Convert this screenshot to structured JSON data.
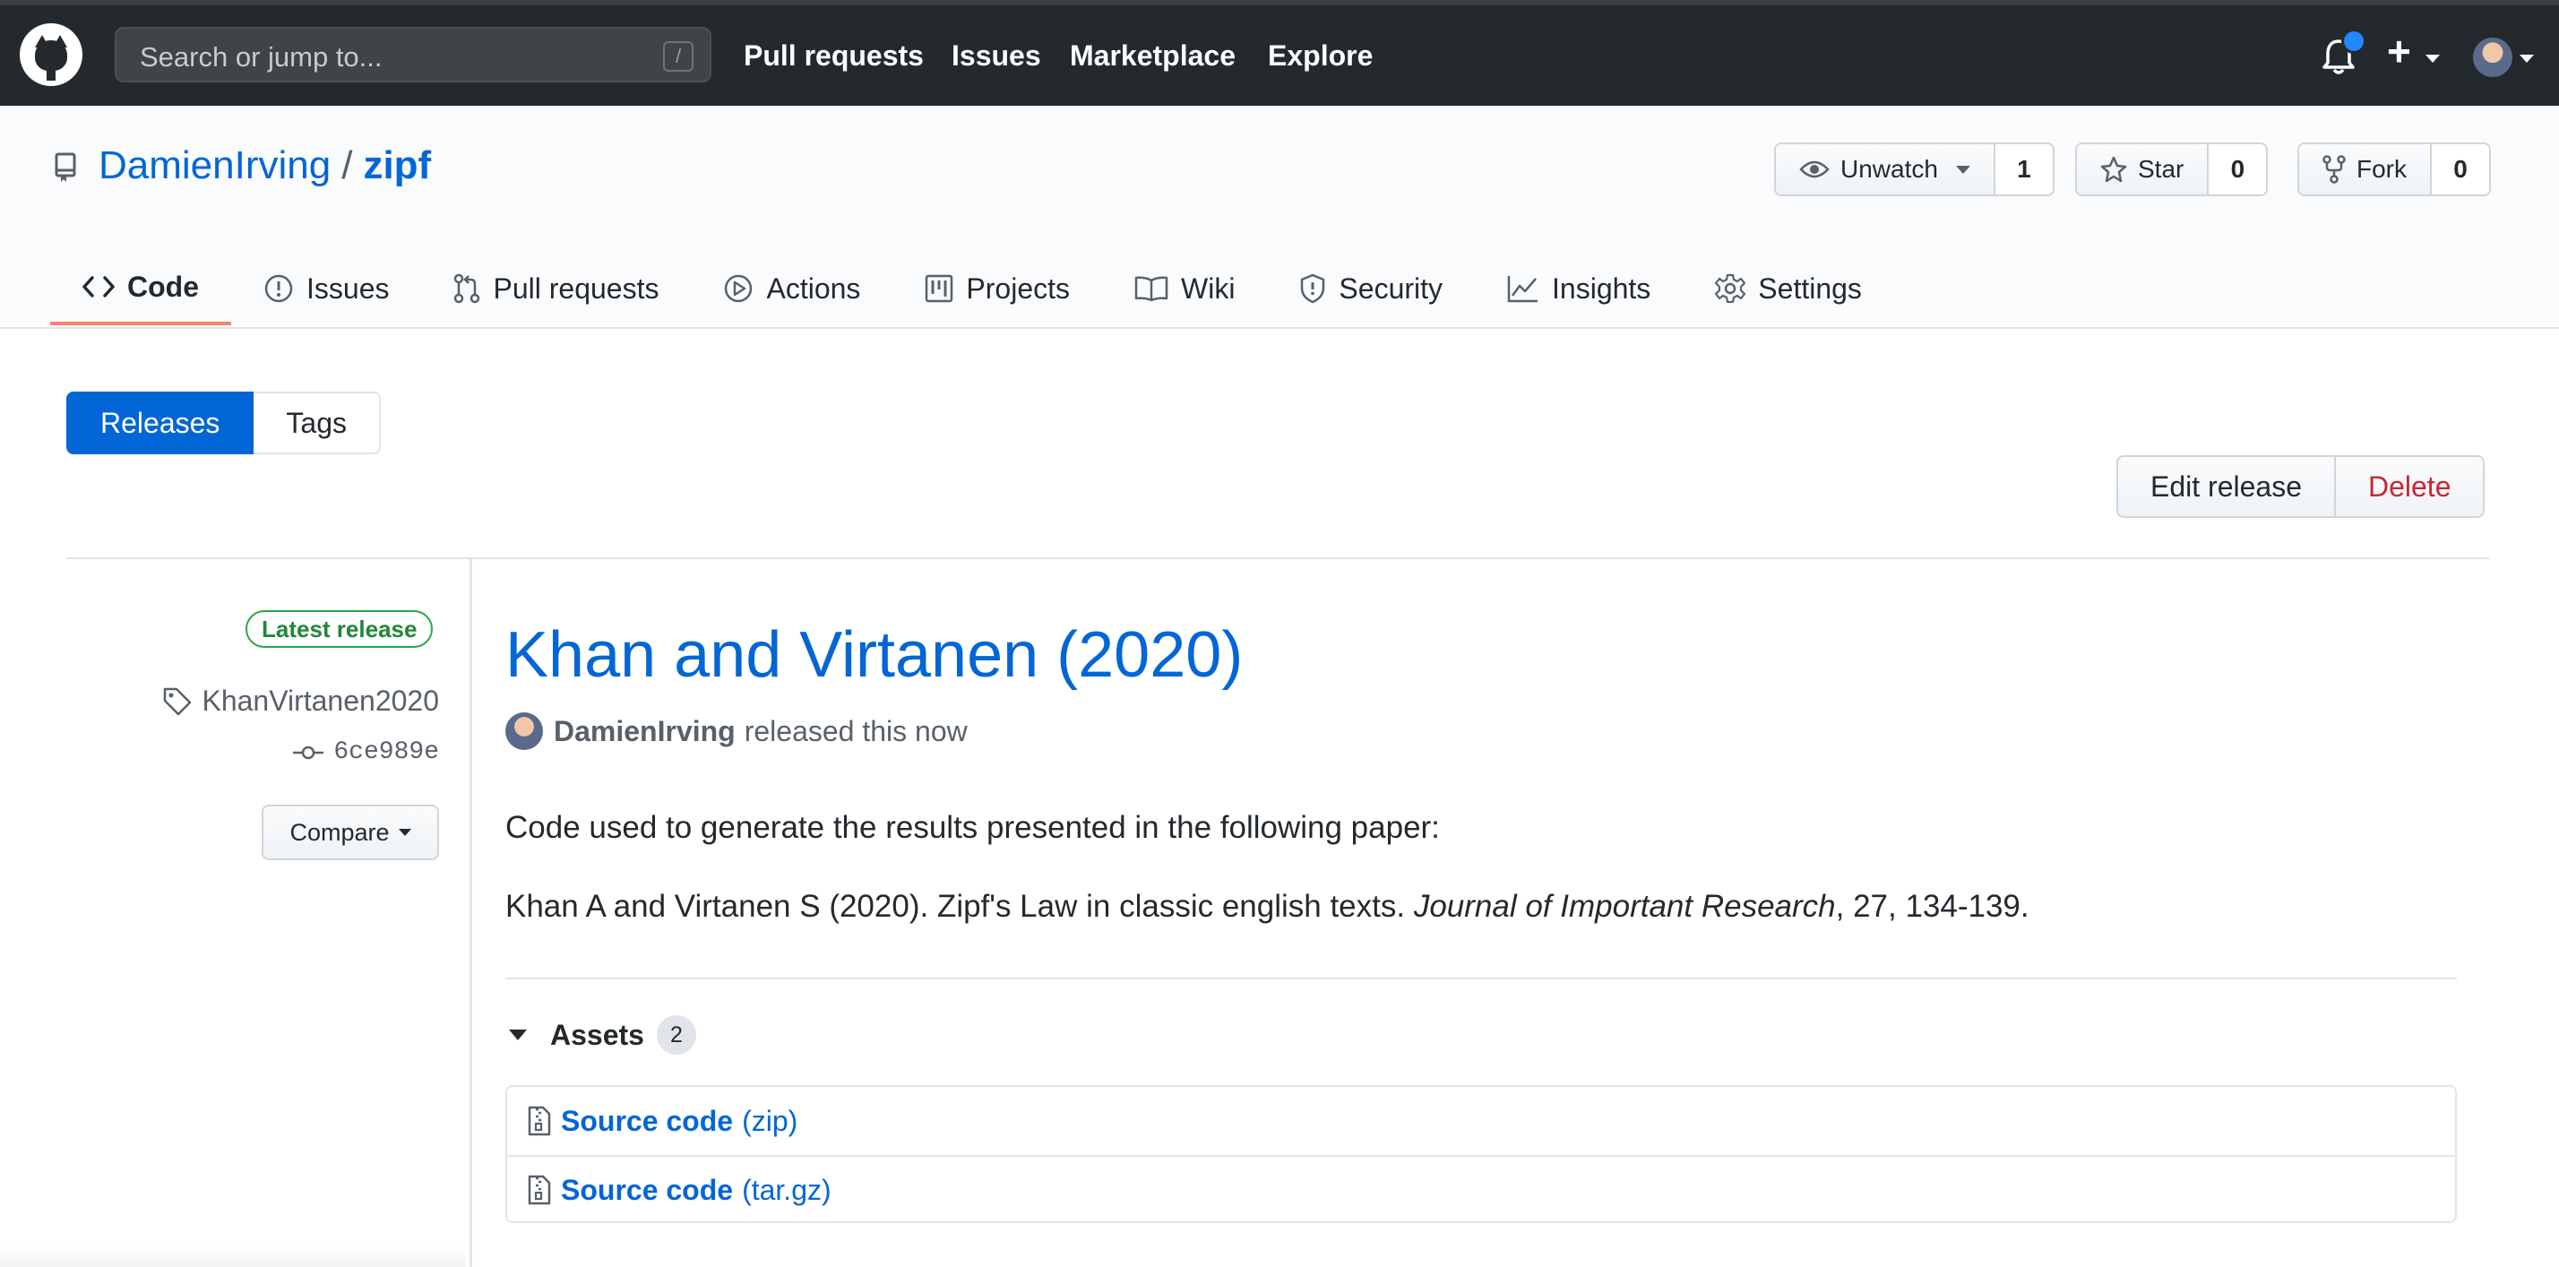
{
  "header": {
    "search_placeholder": "Search or jump to...",
    "search_shortcut": "/",
    "nav": [
      "Pull requests",
      "Issues",
      "Marketplace",
      "Explore"
    ],
    "plus_label": "+"
  },
  "repo": {
    "owner": "DamienIrving",
    "separator": "/",
    "name": "zipf",
    "watch_label": "Unwatch",
    "watch_count": "1",
    "star_label": "Star",
    "star_count": "0",
    "fork_label": "Fork",
    "fork_count": "0"
  },
  "tabs": [
    {
      "label": "Code",
      "icon": "code-icon",
      "selected": true
    },
    {
      "label": "Issues",
      "icon": "issue-icon"
    },
    {
      "label": "Pull requests",
      "icon": "pull-request-icon"
    },
    {
      "label": "Actions",
      "icon": "play-icon"
    },
    {
      "label": "Projects",
      "icon": "project-icon"
    },
    {
      "label": "Wiki",
      "icon": "book-icon"
    },
    {
      "label": "Security",
      "icon": "shield-icon"
    },
    {
      "label": "Insights",
      "icon": "graph-icon"
    },
    {
      "label": "Settings",
      "icon": "gear-icon"
    }
  ],
  "subnav": {
    "releases": "Releases",
    "tags": "Tags"
  },
  "actions": {
    "edit": "Edit release",
    "delete": "Delete"
  },
  "release": {
    "badge": "Latest release",
    "tag": "KhanVirtanen2020",
    "commit": "6ce989e",
    "compare": "Compare",
    "title": "Khan and Virtanen (2020)",
    "author": "DamienIrving",
    "released_text": "released this now",
    "body_line1": "Code used to generate the results presented in the following paper:",
    "citation_prefix": "Khan A and Virtanen S (2020). Zipf's Law in classic english texts. ",
    "citation_journal": "Journal of Important Research",
    "citation_suffix": ", 27, 134-139."
  },
  "assets": {
    "label": "Assets",
    "count": "2",
    "items": [
      {
        "name": "Source code",
        "format": "(zip)"
      },
      {
        "name": "Source code",
        "format": "(tar.gz)"
      }
    ]
  },
  "colors": {
    "header_bg": "#24292e",
    "link": "#0366d6",
    "danger": "#cb2431",
    "success": "#28a745",
    "tab_underline": "#f9826c"
  }
}
